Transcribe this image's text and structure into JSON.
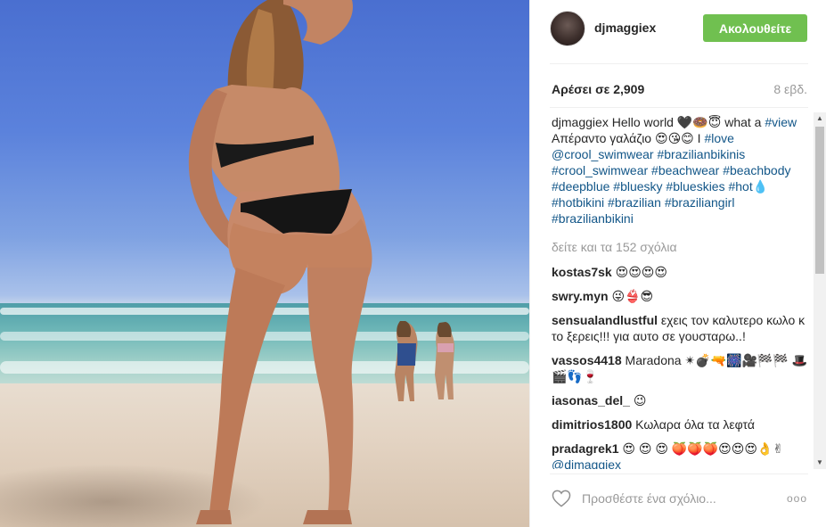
{
  "post": {
    "username": "djmaggiex",
    "follow_label": "Ακολουθείτε",
    "likes": "Αρέσει σε 2,909",
    "age": "8 εβδ.",
    "caption": {
      "author": "djmaggiex",
      "text_before": "Hello world 🖤🍩😇 what a",
      "tag_view": "#view",
      "text_middle": "Απέραντο γαλάζιο 😍😘😊 I",
      "tag_love": "#love",
      "tags_line": "@crool_swimwear #brazilianbikinis #crool_swimwear #beachwear #beachbody #deepblue #bluesky #blueskies #hot💧 #hotbikini #brazilian #braziliangirl #brazilianbikini"
    },
    "view_all": "δείτε και τα 152 σχόλια",
    "comments": [
      {
        "author": "kostas7sk",
        "text": "😍😍😍😍"
      },
      {
        "author": "swry.myn",
        "text": "😜👙😎"
      },
      {
        "author": "sensualandlustful",
        "text": "εχεις τον καλυτερο κωλο κ το ξερεις!!! για αυτο σε γουσταρω..!"
      },
      {
        "author": "vassos4418",
        "text": "Maradona ✴💣🔫🎆🎥🏁🏁 🎩🎬👣🍷"
      },
      {
        "author": "iasonas_del_",
        "text": "😉"
      },
      {
        "author": "dimitrios1800",
        "text": "Κωλαρα όλα τα λεφτά"
      },
      {
        "author": "pradagrek1",
        "text": "😍 😍 😍 🍑🍑🍑😍😍😍👌✌",
        "mention": "@djmaggiex"
      }
    ],
    "add_comment_placeholder": "Προσθέστε ένα σχόλιο...",
    "more_label": "ooo"
  },
  "icons": {
    "heart": "heart-icon",
    "more": "more-options-icon",
    "scroll_up": "chevron-up-icon",
    "scroll_down": "chevron-down-icon"
  },
  "colors": {
    "follow_button": "#70c050",
    "hashtag": "#125688",
    "muted": "#999999"
  }
}
